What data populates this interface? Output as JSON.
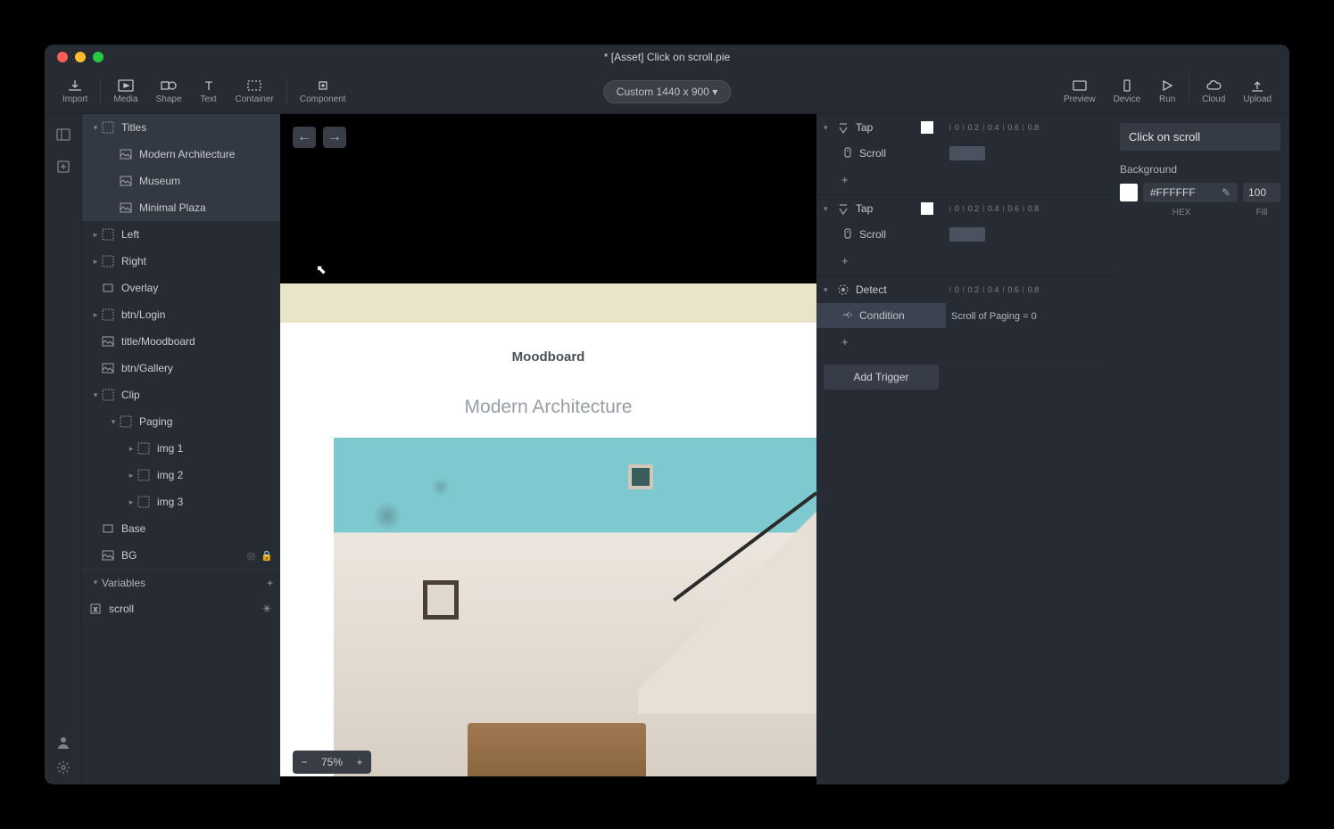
{
  "titlebar": {
    "title": "* [Asset] Click on scroll.pie"
  },
  "toolbar": {
    "import": "Import",
    "media": "Media",
    "shape": "Shape",
    "text": "Text",
    "container": "Container",
    "component": "Component",
    "device_label": "Custom  1440 x 900",
    "device_dropdown": "▾",
    "preview": "Preview",
    "device": "Device",
    "run": "Run",
    "cloud": "Cloud",
    "upload": "Upload"
  },
  "layers": {
    "items": [
      {
        "label": "Titles",
        "indent": 0,
        "chev": "▾",
        "icon": "grid",
        "hl": true
      },
      {
        "label": "Modern Architecture",
        "indent": 1,
        "chev": "",
        "icon": "image",
        "hl": true
      },
      {
        "label": "Museum",
        "indent": 1,
        "chev": "",
        "icon": "image",
        "hl": true
      },
      {
        "label": "Minimal Plaza",
        "indent": 1,
        "chev": "",
        "icon": "image",
        "hl": true
      },
      {
        "label": "Left",
        "indent": 0,
        "chev": "▸",
        "icon": "grid",
        "hl": false
      },
      {
        "label": "Right",
        "indent": 0,
        "chev": "▸",
        "icon": "grid",
        "hl": false
      },
      {
        "label": "Overlay",
        "indent": 0,
        "chev": "",
        "icon": "rect",
        "hl": false
      },
      {
        "label": "btn/Login",
        "indent": 0,
        "chev": "▸",
        "icon": "grid",
        "hl": false
      },
      {
        "label": "title/Moodboard",
        "indent": 0,
        "chev": "",
        "icon": "image",
        "hl": false
      },
      {
        "label": "btn/Gallery",
        "indent": 0,
        "chev": "",
        "icon": "image",
        "hl": false
      },
      {
        "label": "Clip",
        "indent": 0,
        "chev": "▾",
        "icon": "grid",
        "hl": false
      },
      {
        "label": "Paging",
        "indent": 1,
        "chev": "▾",
        "icon": "grid",
        "hl": false
      },
      {
        "label": "img 1",
        "indent": 2,
        "chev": "▸",
        "icon": "grid",
        "hl": false
      },
      {
        "label": "img 2",
        "indent": 2,
        "chev": "▸",
        "icon": "grid",
        "hl": false
      },
      {
        "label": "img 3",
        "indent": 2,
        "chev": "▸",
        "icon": "grid",
        "hl": false
      },
      {
        "label": "Base",
        "indent": 0,
        "chev": "",
        "icon": "rect",
        "hl": false
      },
      {
        "label": "BG",
        "indent": 0,
        "chev": "",
        "icon": "image",
        "hl": false,
        "extras": true
      }
    ],
    "variables_header": "Variables",
    "variable": "scroll"
  },
  "canvas": {
    "moodboard": "Moodboard",
    "subtitle": "Modern Architecture",
    "zoom": "75%"
  },
  "triggers": {
    "ruler": [
      "0",
      "0.2",
      "0.4",
      "0.6",
      "0.8"
    ],
    "blocks": [
      {
        "head": "Tap",
        "icon": "tap",
        "swatch": true,
        "subs": [
          {
            "label": "Scroll",
            "bar": true
          }
        ],
        "ruler": true
      },
      {
        "head": "Tap",
        "icon": "tap",
        "swatch": true,
        "subs": [
          {
            "label": "Scroll",
            "bar": true
          }
        ],
        "ruler": true
      },
      {
        "head": "Detect",
        "icon": "detect",
        "swatch": false,
        "subs": [
          {
            "label": "Condition",
            "sel": true,
            "text": "Scroll of Paging = 0"
          }
        ],
        "ruler": true
      }
    ],
    "add_trigger": "Add Trigger"
  },
  "inspector": {
    "title": "Click on scroll",
    "background_label": "Background",
    "hex": "#FFFFFF",
    "fill": "100",
    "hex_label": "HEX",
    "fill_label": "Fill"
  }
}
